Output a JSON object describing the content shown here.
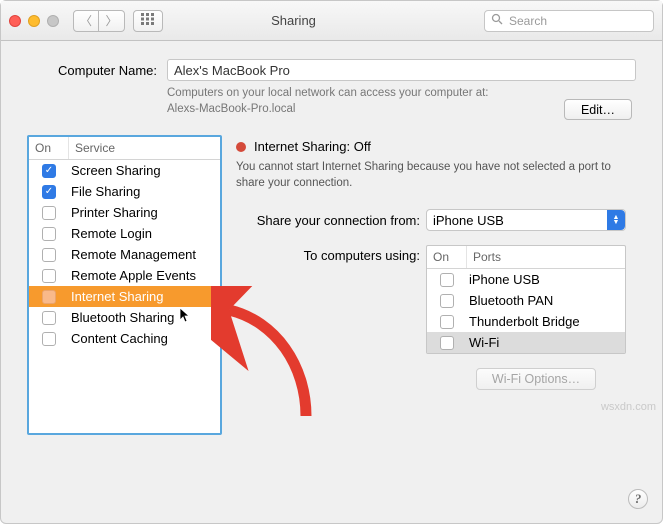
{
  "window": {
    "title": "Sharing"
  },
  "search": {
    "placeholder": "Search"
  },
  "computer_name": {
    "label": "Computer Name:",
    "value": "Alex's MacBook Pro",
    "hint_line1": "Computers on your local network can access your computer at:",
    "hint_line2": "Alexs-MacBook-Pro.local",
    "edit": "Edit…"
  },
  "services": {
    "header_on": "On",
    "header_service": "Service",
    "items": [
      {
        "label": "Screen Sharing",
        "checked": true,
        "selected": false
      },
      {
        "label": "File Sharing",
        "checked": true,
        "selected": false
      },
      {
        "label": "Printer Sharing",
        "checked": false,
        "selected": false
      },
      {
        "label": "Remote Login",
        "checked": false,
        "selected": false
      },
      {
        "label": "Remote Management",
        "checked": false,
        "selected": false
      },
      {
        "label": "Remote Apple Events",
        "checked": false,
        "selected": false
      },
      {
        "label": "Internet Sharing",
        "checked": false,
        "selected": true
      },
      {
        "label": "Bluetooth Sharing",
        "checked": false,
        "selected": false
      },
      {
        "label": "Content Caching",
        "checked": false,
        "selected": false
      }
    ]
  },
  "detail": {
    "status_title": "Internet Sharing: Off",
    "status_dot_color": "#d44a3a",
    "description": "You cannot start Internet Sharing because you have not selected a port to share your connection.",
    "share_from_label": "Share your connection from:",
    "share_from_value": "iPhone USB",
    "to_computers_label": "To computers using:",
    "ports_header_on": "On",
    "ports_header_ports": "Ports",
    "ports": [
      {
        "label": "iPhone USB",
        "checked": false,
        "selected": false
      },
      {
        "label": "Bluetooth PAN",
        "checked": false,
        "selected": false
      },
      {
        "label": "Thunderbolt Bridge",
        "checked": false,
        "selected": false
      },
      {
        "label": "Wi-Fi",
        "checked": false,
        "selected": true
      }
    ],
    "wifi_options": "Wi-Fi Options…"
  },
  "watermark": "wsxdn.com",
  "help": "?"
}
